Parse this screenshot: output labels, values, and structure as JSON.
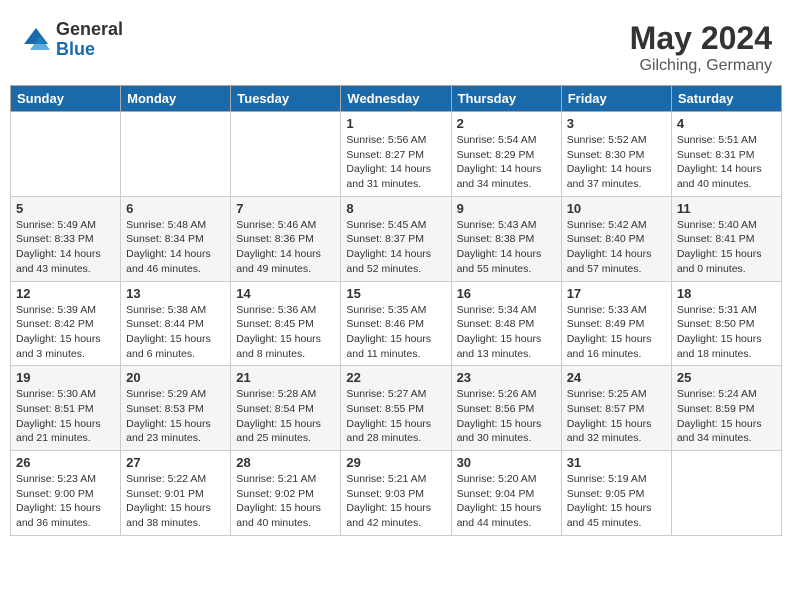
{
  "header": {
    "logo_general": "General",
    "logo_blue": "Blue",
    "month_year": "May 2024",
    "location": "Gilching, Germany"
  },
  "days_of_week": [
    "Sunday",
    "Monday",
    "Tuesday",
    "Wednesday",
    "Thursday",
    "Friday",
    "Saturday"
  ],
  "weeks": [
    [
      {
        "day": "",
        "info": ""
      },
      {
        "day": "",
        "info": ""
      },
      {
        "day": "",
        "info": ""
      },
      {
        "day": "1",
        "info": "Sunrise: 5:56 AM\nSunset: 8:27 PM\nDaylight: 14 hours\nand 31 minutes."
      },
      {
        "day": "2",
        "info": "Sunrise: 5:54 AM\nSunset: 8:29 PM\nDaylight: 14 hours\nand 34 minutes."
      },
      {
        "day": "3",
        "info": "Sunrise: 5:52 AM\nSunset: 8:30 PM\nDaylight: 14 hours\nand 37 minutes."
      },
      {
        "day": "4",
        "info": "Sunrise: 5:51 AM\nSunset: 8:31 PM\nDaylight: 14 hours\nand 40 minutes."
      }
    ],
    [
      {
        "day": "5",
        "info": "Sunrise: 5:49 AM\nSunset: 8:33 PM\nDaylight: 14 hours\nand 43 minutes."
      },
      {
        "day": "6",
        "info": "Sunrise: 5:48 AM\nSunset: 8:34 PM\nDaylight: 14 hours\nand 46 minutes."
      },
      {
        "day": "7",
        "info": "Sunrise: 5:46 AM\nSunset: 8:36 PM\nDaylight: 14 hours\nand 49 minutes."
      },
      {
        "day": "8",
        "info": "Sunrise: 5:45 AM\nSunset: 8:37 PM\nDaylight: 14 hours\nand 52 minutes."
      },
      {
        "day": "9",
        "info": "Sunrise: 5:43 AM\nSunset: 8:38 PM\nDaylight: 14 hours\nand 55 minutes."
      },
      {
        "day": "10",
        "info": "Sunrise: 5:42 AM\nSunset: 8:40 PM\nDaylight: 14 hours\nand 57 minutes."
      },
      {
        "day": "11",
        "info": "Sunrise: 5:40 AM\nSunset: 8:41 PM\nDaylight: 15 hours\nand 0 minutes."
      }
    ],
    [
      {
        "day": "12",
        "info": "Sunrise: 5:39 AM\nSunset: 8:42 PM\nDaylight: 15 hours\nand 3 minutes."
      },
      {
        "day": "13",
        "info": "Sunrise: 5:38 AM\nSunset: 8:44 PM\nDaylight: 15 hours\nand 6 minutes."
      },
      {
        "day": "14",
        "info": "Sunrise: 5:36 AM\nSunset: 8:45 PM\nDaylight: 15 hours\nand 8 minutes."
      },
      {
        "day": "15",
        "info": "Sunrise: 5:35 AM\nSunset: 8:46 PM\nDaylight: 15 hours\nand 11 minutes."
      },
      {
        "day": "16",
        "info": "Sunrise: 5:34 AM\nSunset: 8:48 PM\nDaylight: 15 hours\nand 13 minutes."
      },
      {
        "day": "17",
        "info": "Sunrise: 5:33 AM\nSunset: 8:49 PM\nDaylight: 15 hours\nand 16 minutes."
      },
      {
        "day": "18",
        "info": "Sunrise: 5:31 AM\nSunset: 8:50 PM\nDaylight: 15 hours\nand 18 minutes."
      }
    ],
    [
      {
        "day": "19",
        "info": "Sunrise: 5:30 AM\nSunset: 8:51 PM\nDaylight: 15 hours\nand 21 minutes."
      },
      {
        "day": "20",
        "info": "Sunrise: 5:29 AM\nSunset: 8:53 PM\nDaylight: 15 hours\nand 23 minutes."
      },
      {
        "day": "21",
        "info": "Sunrise: 5:28 AM\nSunset: 8:54 PM\nDaylight: 15 hours\nand 25 minutes."
      },
      {
        "day": "22",
        "info": "Sunrise: 5:27 AM\nSunset: 8:55 PM\nDaylight: 15 hours\nand 28 minutes."
      },
      {
        "day": "23",
        "info": "Sunrise: 5:26 AM\nSunset: 8:56 PM\nDaylight: 15 hours\nand 30 minutes."
      },
      {
        "day": "24",
        "info": "Sunrise: 5:25 AM\nSunset: 8:57 PM\nDaylight: 15 hours\nand 32 minutes."
      },
      {
        "day": "25",
        "info": "Sunrise: 5:24 AM\nSunset: 8:59 PM\nDaylight: 15 hours\nand 34 minutes."
      }
    ],
    [
      {
        "day": "26",
        "info": "Sunrise: 5:23 AM\nSunset: 9:00 PM\nDaylight: 15 hours\nand 36 minutes."
      },
      {
        "day": "27",
        "info": "Sunrise: 5:22 AM\nSunset: 9:01 PM\nDaylight: 15 hours\nand 38 minutes."
      },
      {
        "day": "28",
        "info": "Sunrise: 5:21 AM\nSunset: 9:02 PM\nDaylight: 15 hours\nand 40 minutes."
      },
      {
        "day": "29",
        "info": "Sunrise: 5:21 AM\nSunset: 9:03 PM\nDaylight: 15 hours\nand 42 minutes."
      },
      {
        "day": "30",
        "info": "Sunrise: 5:20 AM\nSunset: 9:04 PM\nDaylight: 15 hours\nand 44 minutes."
      },
      {
        "day": "31",
        "info": "Sunrise: 5:19 AM\nSunset: 9:05 PM\nDaylight: 15 hours\nand 45 minutes."
      },
      {
        "day": "",
        "info": ""
      }
    ]
  ]
}
